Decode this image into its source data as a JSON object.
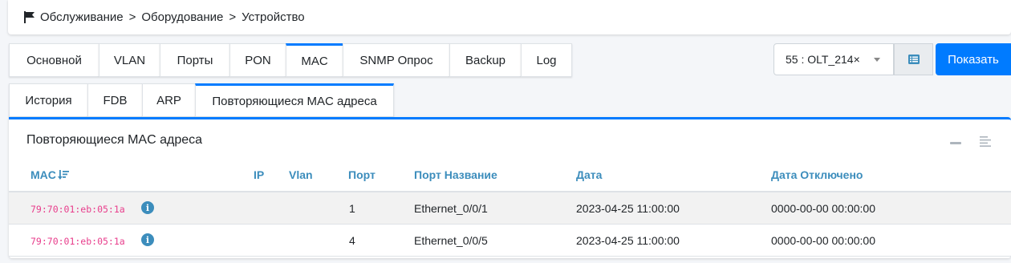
{
  "breadcrumb": {
    "items": [
      "Обслуживание",
      "Оборудование",
      "Устройство"
    ],
    "separator": ">"
  },
  "main_tabs": [
    {
      "label": "Основной",
      "active": false
    },
    {
      "label": "VLAN",
      "active": false
    },
    {
      "label": "Порты",
      "active": false
    },
    {
      "label": "PON",
      "active": false
    },
    {
      "label": "MAC",
      "active": true
    },
    {
      "label": "SNMP Опрос",
      "active": false
    },
    {
      "label": "Backup",
      "active": false
    },
    {
      "label": "Log",
      "active": false
    }
  ],
  "device_select": {
    "value": "55 : OLT_214",
    "clear": "×"
  },
  "show_button": "Показать",
  "sub_tabs": [
    {
      "label": "История",
      "active": false
    },
    {
      "label": "FDB",
      "active": false
    },
    {
      "label": "ARP",
      "active": false
    },
    {
      "label": "Повторяющиеся MAC адреса",
      "active": true
    }
  ],
  "card": {
    "title": "Повторяющиеся MAC адреса",
    "columns": [
      "MAC",
      "IP",
      "Vlan",
      "Порт",
      "Порт Название",
      "Дата",
      "Дата Отключено"
    ],
    "rows": [
      {
        "mac": "79:70:01:eb:05:1a",
        "ip": "",
        "vlan": "",
        "port": "1",
        "port_name": "Ethernet_0/0/1",
        "date": "2023-04-25 11:00:00",
        "date_off": "0000-00-00 00:00:00"
      },
      {
        "mac": "79:70:01:eb:05:1a",
        "ip": "",
        "vlan": "",
        "port": "4",
        "port_name": "Ethernet_0/0/5",
        "date": "2023-04-25 11:00:00",
        "date_off": "0000-00-00 00:00:00"
      }
    ]
  },
  "colors": {
    "accent": "#007bff",
    "header_text": "#3c8dbc",
    "mac_text": "#e83e8c"
  },
  "icons": {
    "breadcrumb": "flag-icon",
    "list": "list-icon",
    "sort": "sort-desc-icon",
    "info": "info-icon",
    "minimize": "minus-icon",
    "menu": "menu-icon"
  }
}
